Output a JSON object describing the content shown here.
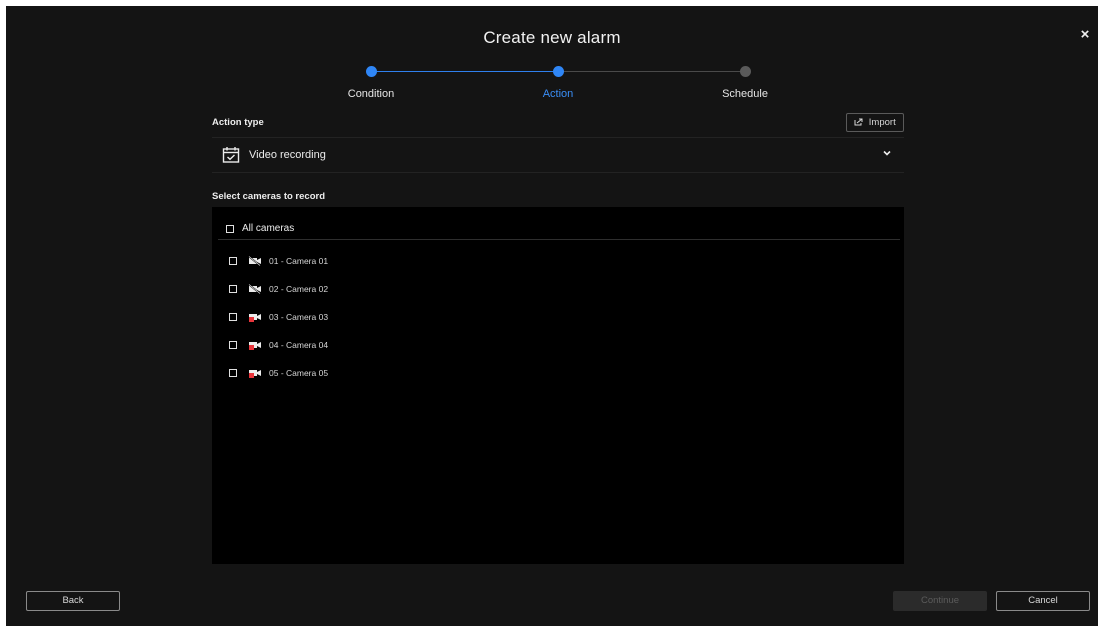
{
  "dialog": {
    "title": "Create new alarm",
    "close_icon": "×"
  },
  "stepper": {
    "steps": [
      {
        "label": "Condition",
        "state": "done"
      },
      {
        "label": "Action",
        "state": "current"
      },
      {
        "label": "Schedule",
        "state": "todo"
      }
    ]
  },
  "action_type": {
    "label": "Action type",
    "import_label": "Import",
    "import_icon": "import-icon",
    "selected": "Video recording",
    "selected_icon": "calendar-check-icon"
  },
  "cameras": {
    "label": "Select cameras to record",
    "all_label": "All cameras",
    "items": [
      {
        "name": "01 - Camera 01",
        "status": "offline"
      },
      {
        "name": "02 - Camera 02",
        "status": "offline"
      },
      {
        "name": "03 - Camera 03",
        "status": "recording"
      },
      {
        "name": "04 - Camera 04",
        "status": "recording"
      },
      {
        "name": "05 - Camera 05",
        "status": "recording"
      }
    ]
  },
  "footer": {
    "back_label": "Back",
    "continue_label": "Continue",
    "cancel_label": "Cancel"
  },
  "colors": {
    "accent": "#2f86f6",
    "background": "#141414",
    "panel": "#000000",
    "recording": "#e8353b"
  }
}
